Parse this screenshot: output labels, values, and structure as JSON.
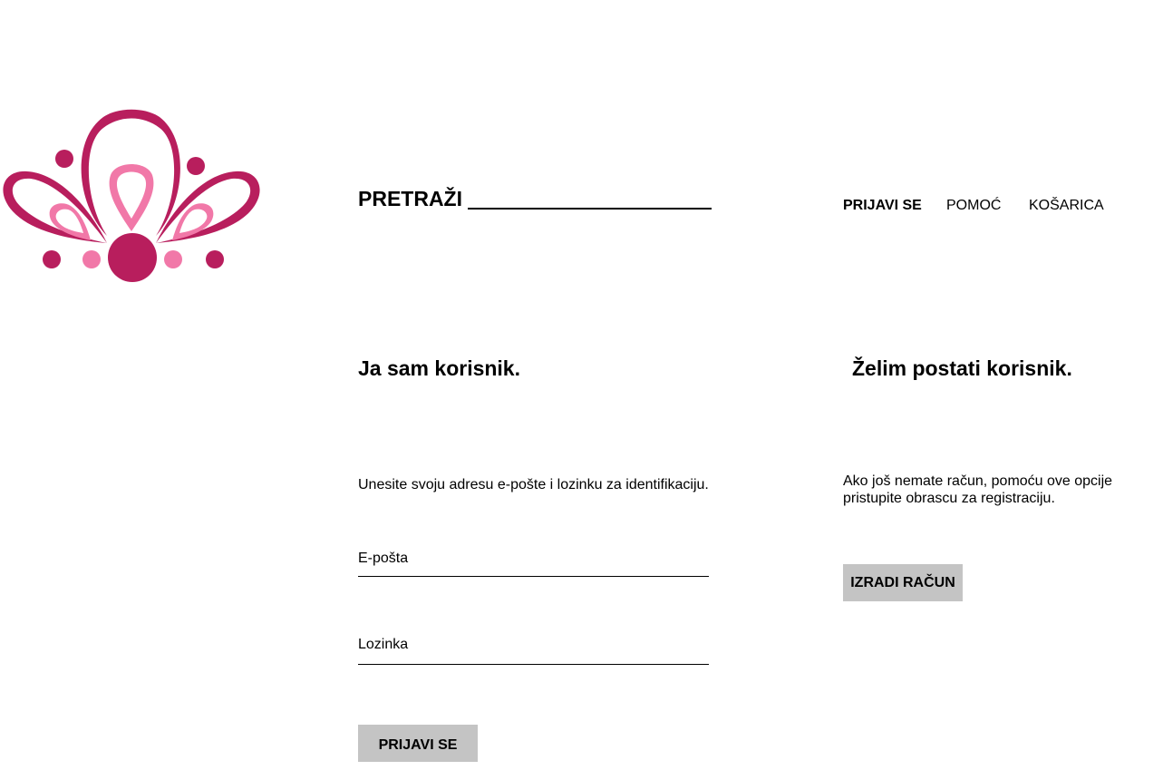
{
  "colors": {
    "brand_dark": "#b81e5d",
    "brand_light": "#f178a8",
    "button_bg": "#c4c4c4"
  },
  "logo": {
    "icon": "lotus-logo"
  },
  "header": {
    "search_label": "PRETRAŽI",
    "search_value": "",
    "nav": {
      "login": "PRIJAVI SE",
      "help": "POMOĆ",
      "cart": "KOŠARICA"
    }
  },
  "login_section": {
    "title": "Ja sam korisnik.",
    "description": "Unesite svoju adresu e-pošte i lozinku za identifikaciju.",
    "email_label": "E-pošta",
    "email_value": "",
    "password_label": "Lozinka",
    "password_value": "",
    "submit_label": "PRIJAVI SE"
  },
  "register_section": {
    "title": "Želim postati korisnik.",
    "description": "Ako još nemate račun, pomoću ove opcije pristupite obrascu za registraciju.",
    "button_label": "IZRADI RAČUN"
  }
}
